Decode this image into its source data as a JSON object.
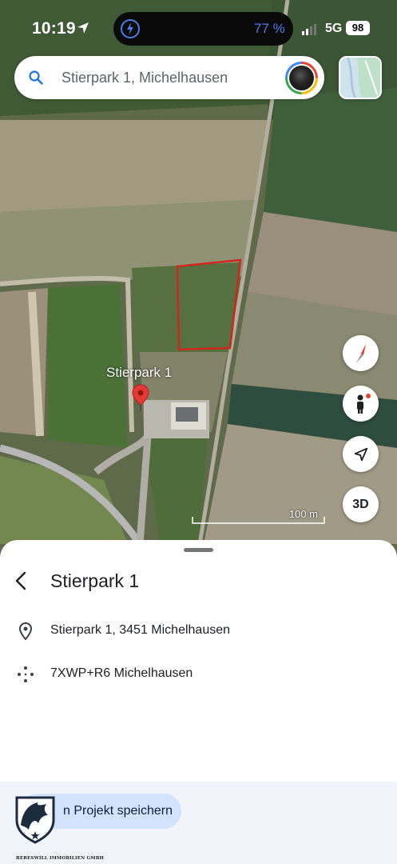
{
  "status_bar": {
    "time": "10:19",
    "battery_percent": "77 %",
    "network": "5G",
    "battery_level": "98"
  },
  "search": {
    "text": "Stierpark 1, Michelhausen"
  },
  "map": {
    "pin_label": "Stierpark 1",
    "scale_label": "100 m",
    "btn_3d_label": "3D"
  },
  "place": {
    "title": "Stierpark 1",
    "address": "Stierpark 1, 3451 Michelhausen",
    "plus_code": "7XWP+R6 Michelhausen"
  },
  "actions": {
    "save_label": "n Projekt speichern"
  },
  "logo": {
    "caption": "BERESWILL IMMOBILIEN GMBH"
  },
  "colors": {
    "accent_blue": "#4a7fe8",
    "save_button": "#d3e3fd",
    "pin_red": "#e53935",
    "parcel_outline": "#d0261d"
  }
}
